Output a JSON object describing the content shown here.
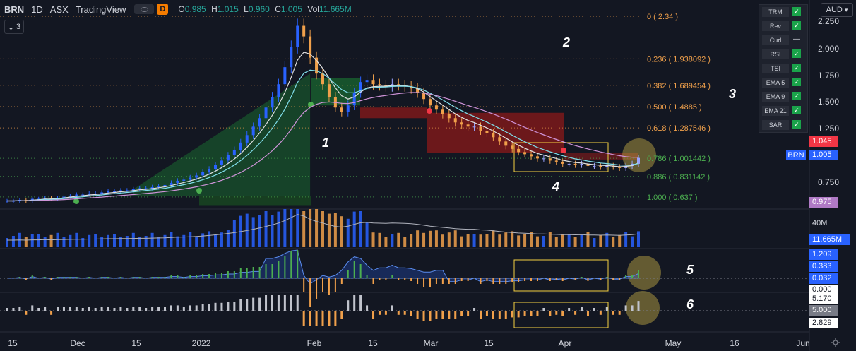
{
  "header": {
    "symbol": "BRN",
    "interval": "1D",
    "exchange": "ASX",
    "platform": "TradingView",
    "badge": "D",
    "ohlc": [
      {
        "key": "O",
        "value": "0.985"
      },
      {
        "key": "H",
        "value": "1.015"
      },
      {
        "key": "L",
        "value": "0.960"
      },
      {
        "key": "C",
        "value": "1.005"
      },
      {
        "key": "Vol",
        "value": "11.665M"
      }
    ],
    "collapse_count": "3"
  },
  "currency": "AUD",
  "price_axis": [
    "2.250",
    "2.000",
    "1.750",
    "1.500",
    "1.250",
    "0.750"
  ],
  "price_badges": {
    "high": "1.045",
    "symbol_tag": "BRN",
    "last": "1.005",
    "low": "0.975"
  },
  "fib_levels": [
    {
      "label": "0 ( 2.34 )",
      "price": 2.34,
      "color": "#f0a04b"
    },
    {
      "label": "0.236 ( 1.938092 )",
      "price": 1.938092,
      "color": "#f0a04b"
    },
    {
      "label": "0.382 ( 1.689454 )",
      "price": 1.689454,
      "color": "#f0a04b"
    },
    {
      "label": "0.500 ( 1.4885 )",
      "price": 1.4885,
      "color": "#f0a04b"
    },
    {
      "label": "0.618 ( 1.287546 )",
      "price": 1.287546,
      "color": "#f0a04b"
    },
    {
      "label": "0.786 ( 1.001442 )",
      "price": 1.001442,
      "color": "#4caf50"
    },
    {
      "label": "0.886 ( 0.831142 )",
      "price": 0.831142,
      "color": "#4caf50"
    },
    {
      "label": "1.000 ( 0.637 )",
      "price": 0.637,
      "color": "#4caf50"
    }
  ],
  "legend": [
    {
      "name": "TRM",
      "state": "check"
    },
    {
      "name": "Rev",
      "state": "check"
    },
    {
      "name": "Curl",
      "state": "dash"
    },
    {
      "name": "RSI",
      "state": "check"
    },
    {
      "name": "TSI",
      "state": "check"
    },
    {
      "name": "EMA 5",
      "state": "check"
    },
    {
      "name": "EMA 9",
      "state": "check"
    },
    {
      "name": "EMA 21",
      "state": "check"
    },
    {
      "name": "SAR",
      "state": "check"
    }
  ],
  "annotations": [
    "1",
    "2",
    "3",
    "4",
    "5",
    "6"
  ],
  "volume_pane": {
    "axis_label": "40M",
    "last": "11.665M"
  },
  "tsi_pane": {
    "values": [
      "1.209",
      "0.383",
      "0.032",
      "0.000"
    ]
  },
  "rsi_pane": {
    "values": [
      "5.170",
      "5.000",
      "2.829"
    ]
  },
  "time_axis": [
    "15",
    "Dec",
    "15",
    "2022",
    "Feb",
    "15",
    "Mar",
    "15",
    "Apr",
    "15",
    "May",
    "16",
    "Jun"
  ],
  "chart_data": {
    "type": "candlestick",
    "series_close": [
      0.6,
      0.6,
      0.61,
      0.6,
      0.62,
      0.62,
      0.63,
      0.62,
      0.63,
      0.64,
      0.65,
      0.66,
      0.66,
      0.67,
      0.67,
      0.68,
      0.69,
      0.69,
      0.7,
      0.7,
      0.71,
      0.72,
      0.72,
      0.73,
      0.74,
      0.75,
      0.77,
      0.79,
      0.8,
      0.82,
      0.84,
      0.87,
      0.9,
      0.94,
      0.98,
      1.03,
      1.08,
      1.15,
      1.22,
      1.3,
      1.38,
      1.48,
      1.58,
      1.7,
      1.86,
      2.05,
      2.25,
      2.15,
      1.95,
      1.8,
      1.7,
      1.58,
      1.48,
      1.44,
      1.5,
      1.62,
      1.72,
      1.74,
      1.7,
      1.69,
      1.68,
      1.7,
      1.69,
      1.68,
      1.66,
      1.62,
      1.56,
      1.5,
      1.46,
      1.42,
      1.38,
      1.34,
      1.32,
      1.3,
      1.3,
      1.26,
      1.24,
      1.2,
      1.16,
      1.12,
      1.09,
      1.06,
      1.04,
      1.02,
      1.0,
      1.0,
      0.98,
      0.97,
      0.95,
      0.95,
      0.94,
      0.95,
      0.93,
      0.93,
      0.92,
      0.93,
      0.92,
      0.91,
      0.93,
      0.95,
      1.005
    ],
    "ylim": [
      0.55,
      2.4
    ]
  }
}
